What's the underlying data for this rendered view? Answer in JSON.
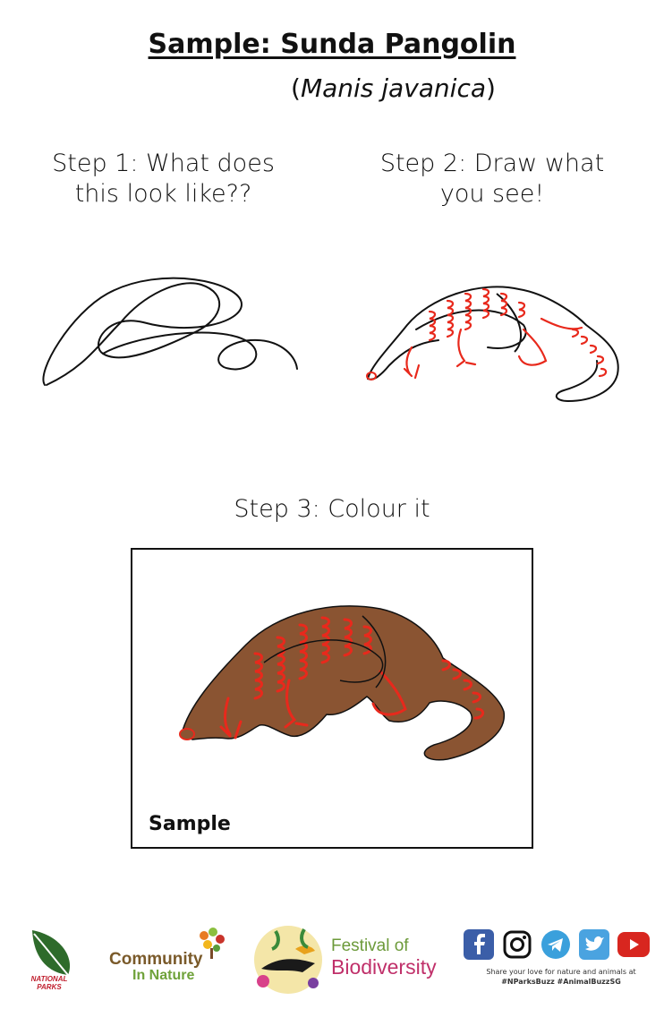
{
  "header": {
    "title": "Sample: Sunda Pangolin",
    "sci_open": "(",
    "sci_name": "Manis javanica",
    "sci_close": ")"
  },
  "steps": {
    "step1": "Step 1: What does this look like??",
    "step2": "Step 2: Draw what you see!",
    "step3": "Step 3: Colour it"
  },
  "sample_box": {
    "label": "Sample"
  },
  "colors": {
    "outline": "#111111",
    "red": "#e8291c",
    "brown": "#8a5432"
  },
  "footer": {
    "nparks_text": "NATIONAL PARKS",
    "community_line1": "Community",
    "community_line2": "In Nature",
    "festival_line1": "Festival of",
    "festival_line2": "Biodiversity",
    "social_icons": [
      "facebook-icon",
      "instagram-icon",
      "telegram-icon",
      "twitter-icon",
      "youtube-icon"
    ],
    "share_text": "Share your love for nature and animals at",
    "hashtags": "#NParksBuzz #AnimalBuzzSG"
  }
}
